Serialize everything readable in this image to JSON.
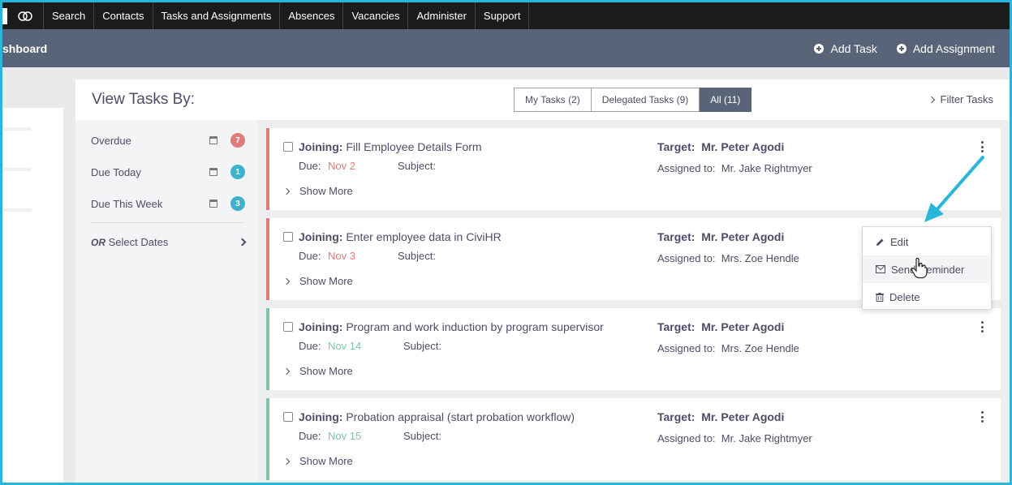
{
  "nav": {
    "items": [
      "Search",
      "Contacts",
      "Tasks and Assignments",
      "Absences",
      "Vacancies",
      "Administer",
      "Support"
    ]
  },
  "header": {
    "title": "shboard",
    "add_task": "Add Task",
    "add_assignment": "Add Assignment"
  },
  "sidebar": {
    "heading": "View Tasks By:",
    "filters": [
      {
        "label": "Overdue",
        "count": "7",
        "color": "#e07b7b"
      },
      {
        "label": "Due Today",
        "count": "1",
        "color": "#3fb1cc"
      },
      {
        "label": "Due This Week",
        "count": "3",
        "color": "#3fb1cc"
      }
    ],
    "select_dates_prefix": "OR",
    "select_dates_label": "Select Dates"
  },
  "tabs": {
    "my_tasks": "My Tasks (2)",
    "delegated": "Delegated Tasks (9)",
    "all": "All (11)",
    "active": "all"
  },
  "filter_tasks": "Filter Tasks",
  "labels": {
    "due": "Due:",
    "subject": "Subject:",
    "target": "Target:",
    "assigned": "Assigned to:",
    "show_more": "Show More"
  },
  "tasks": [
    {
      "type": "Joining:",
      "title": "Fill Employee Details Form",
      "due": "Nov 2",
      "due_color": "#e07b7b",
      "target": "Mr. Peter Agodi",
      "assigned": "Mr. Jake Rightmyer",
      "status": "overdue"
    },
    {
      "type": "Joining:",
      "title": "Enter employee data in CiviHR",
      "due": "Nov 3",
      "due_color": "#e07b7b",
      "target": "Mr. Peter Agodi",
      "assigned": "Mrs. Zoe Hendle",
      "status": "overdue"
    },
    {
      "type": "Joining:",
      "title": "Program and work induction by program supervisor",
      "due": "Nov 14",
      "due_color": "#7fc59f",
      "target": "Mr. Peter Agodi",
      "assigned": "Mrs. Zoe Hendle",
      "status": "upcoming"
    },
    {
      "type": "Joining:",
      "title": "Probation appraisal (start probation workflow)",
      "due": "Nov 15",
      "due_color": "#7fc59f",
      "target": "Mr. Peter Agodi",
      "assigned": "Mr. Jake Rightmyer",
      "status": "upcoming"
    }
  ],
  "context_menu": {
    "edit": "Edit",
    "send_reminder": "Send Reminder",
    "delete": "Delete"
  },
  "colors": {
    "topnav": "#1b1b1b",
    "header": "#5a6478",
    "accent_arrow": "#29b6d8",
    "overdue": "#e07b7b",
    "upcoming": "#7fc59f"
  }
}
